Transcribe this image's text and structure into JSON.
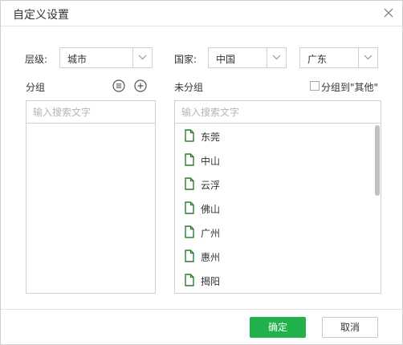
{
  "dialog": {
    "title": "自定义设置",
    "close_icon": "close-icon"
  },
  "level": {
    "label": "层级:",
    "value": "城市"
  },
  "country": {
    "label": "国家:",
    "value": "中国"
  },
  "province": {
    "value": "广东"
  },
  "grouped": {
    "title": "分组",
    "list_icon": "list-icon",
    "add_icon": "plus-circle-icon",
    "search_placeholder": "输入搜索文字"
  },
  "ungrouped": {
    "title": "未分组",
    "other_checkbox_label": "分组到\"其他\"",
    "other_checked": false,
    "search_placeholder": "输入搜索文字",
    "item_icon": "file-icon",
    "items": [
      "东莞",
      "中山",
      "云浮",
      "佛山",
      "广州",
      "惠州",
      "揭阳"
    ]
  },
  "footer": {
    "ok_label": "确定",
    "cancel_label": "取消"
  },
  "colors": {
    "accent": "#21b24b",
    "file_icon": "#2e7d32"
  }
}
